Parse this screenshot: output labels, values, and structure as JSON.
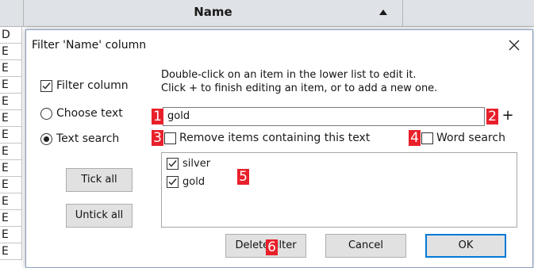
{
  "background": {
    "column_header": "Name",
    "row_labels": [
      "D",
      "E",
      "E",
      "E",
      "E",
      "E",
      "E",
      "E",
      "E",
      "E",
      "E",
      "E",
      "E",
      "E"
    ]
  },
  "dialog": {
    "title": "Filter 'Name' column",
    "filter_column_label": "Filter column",
    "choose_text_label": "Choose text",
    "text_search_label": "Text search",
    "tick_all_label": "Tick all",
    "untick_all_label": "Untick all",
    "instructions_line1": "Double-click on an item in the lower list to edit it.",
    "instructions_line2": "Click + to finish editing an item, or to add a new one.",
    "search_value": "gold",
    "plus_label": "+",
    "remove_items_label": "Remove items containing this text",
    "word_search_label": "Word search",
    "list_items": [
      "silver",
      "gold"
    ],
    "delete_filter_label": "Delete filter",
    "cancel_label": "Cancel",
    "ok_label": "OK",
    "state": {
      "filter_column_checked": true,
      "selected_mode": "text_search",
      "remove_items_checked": false,
      "word_search_checked": false,
      "silver_checked": true,
      "gold_checked": true
    }
  },
  "markers": [
    "1",
    "2",
    "3",
    "4",
    "5",
    "6"
  ],
  "colors": {
    "accent": "#0078d7",
    "marker": "#e8202a",
    "header_bg": "#dfe3e8"
  }
}
